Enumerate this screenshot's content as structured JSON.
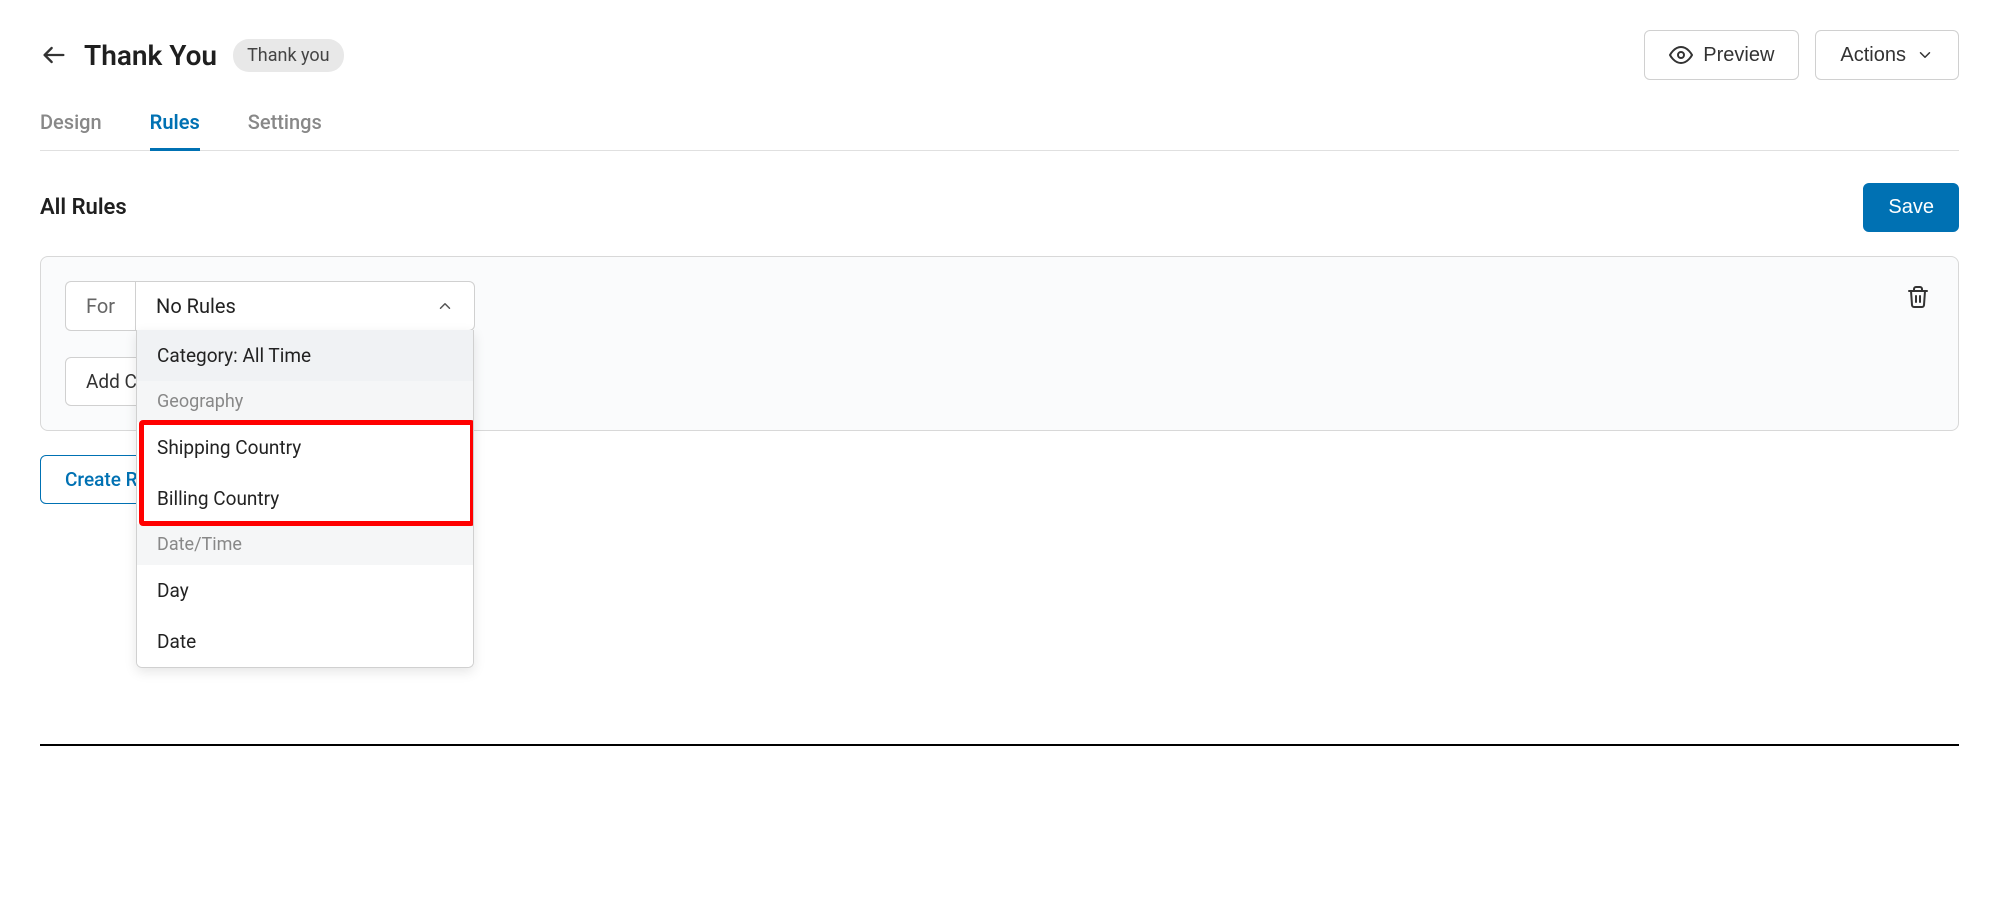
{
  "header": {
    "title": "Thank You",
    "badge": "Thank you",
    "preview_label": "Preview",
    "actions_label": "Actions"
  },
  "tabs": {
    "design": "Design",
    "rules": "Rules",
    "settings": "Settings"
  },
  "section": {
    "title": "All Rules",
    "save_label": "Save"
  },
  "rule": {
    "for_label": "For",
    "selected_value": "No Rules",
    "add_condition_label": "Add Condition"
  },
  "dropdown": {
    "item_category_all_time": "Category: All Time",
    "group_geography": "Geography",
    "item_shipping_country": "Shipping Country",
    "item_billing_country": "Billing Country",
    "group_datetime": "Date/Time",
    "item_day": "Day",
    "item_date": "Date"
  },
  "create_rule_label": "Create Rule"
}
